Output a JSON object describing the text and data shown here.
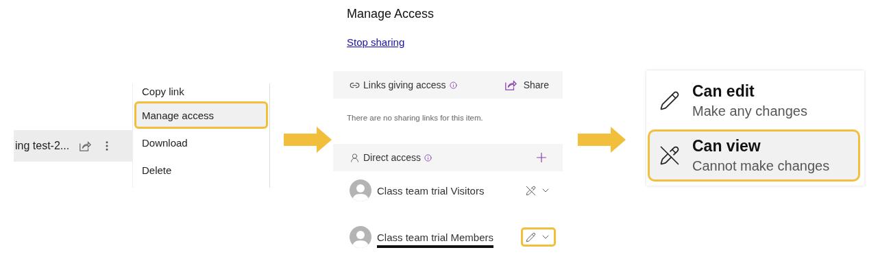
{
  "file_row": {
    "name": "ing test-2..."
  },
  "context_menu": {
    "items": [
      {
        "label": "Copy link",
        "selected": false
      },
      {
        "label": "Manage access",
        "selected": true
      },
      {
        "label": "Download",
        "selected": false
      },
      {
        "label": "Delete",
        "selected": false
      }
    ]
  },
  "manage_access": {
    "title": "Manage Access",
    "stop_sharing": "Stop sharing",
    "links_section": {
      "title": "Links giving access",
      "share_button": "Share",
      "empty_message": "There are no sharing links for this item."
    },
    "direct_access": {
      "title": "Direct access",
      "members": [
        {
          "name": "Class team trial Visitors",
          "kind": "view",
          "highlighted": false,
          "underlined": false
        },
        {
          "name": "Class team trial Members",
          "kind": "edit",
          "highlighted": true,
          "underlined": true
        }
      ]
    }
  },
  "permission_menu": {
    "options": [
      {
        "kind": "edit",
        "title": "Can edit",
        "description": "Make any changes",
        "selected": false
      },
      {
        "kind": "view",
        "title": "Can view",
        "description": "Cannot make changes",
        "selected": true
      }
    ]
  }
}
